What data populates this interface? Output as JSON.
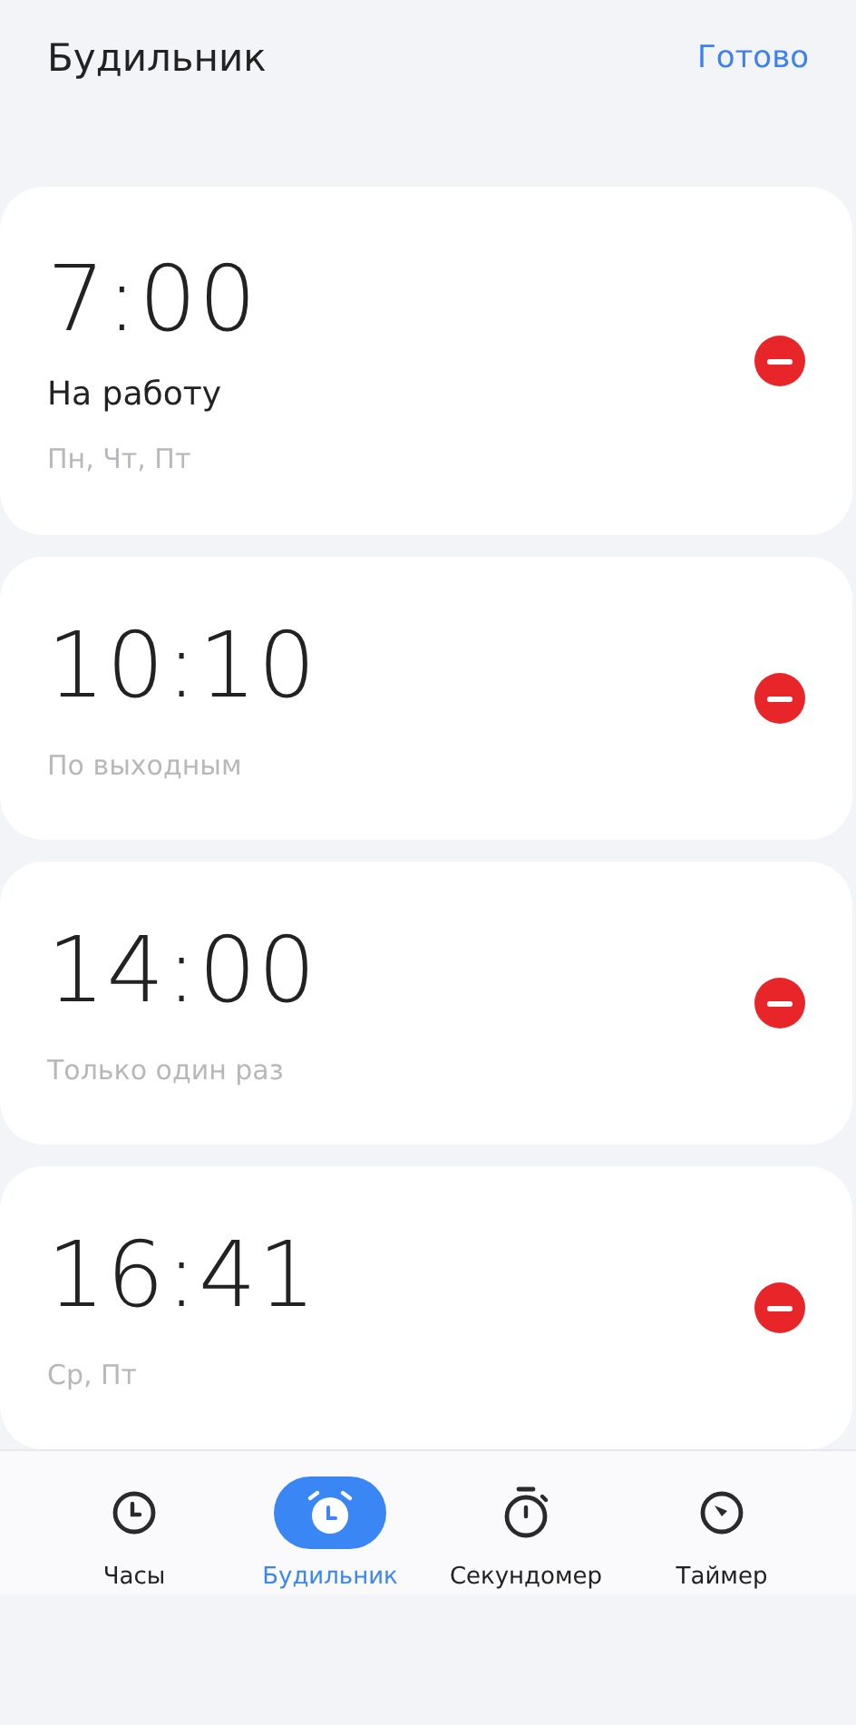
{
  "header": {
    "title": "Будильник",
    "done": "Готово"
  },
  "alarms": [
    {
      "time": "7:00",
      "label": "На работу",
      "repeat": "Пн, Чт, Пт"
    },
    {
      "time": "10:10",
      "repeat": "По выходным"
    },
    {
      "time": "14:00",
      "repeat": "Только один раз"
    },
    {
      "time": "16:41",
      "repeat": "Ср, Пт"
    }
  ],
  "nav": [
    {
      "kind": "clock",
      "label": "Часы",
      "selected": false
    },
    {
      "kind": "alarm",
      "label": "Будильник",
      "selected": true
    },
    {
      "kind": "stopwatch",
      "label": "Секундомер",
      "selected": false
    },
    {
      "kind": "timer",
      "label": "Таймер",
      "selected": false
    }
  ]
}
